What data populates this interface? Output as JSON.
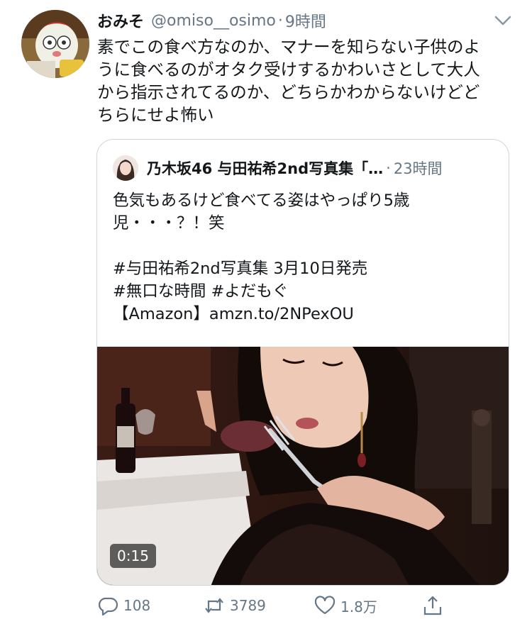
{
  "tweet": {
    "display_name": "おみそ",
    "handle": "@omiso__osimo",
    "separator": "·",
    "time": "9時間",
    "text_lines": [
      "素でこの食べ方なのか、マナーを知らない子供のよ",
      "うに食べるのがオタク受けするかわいさとして大人",
      "から指示されてるのか、どちらかわからないけどど",
      "ちらにせよ怖い"
    ]
  },
  "quote": {
    "display_name": "乃木坂46 与田祐希2nd写真集「…",
    "separator": "·",
    "time": "23時間",
    "text_lines": [
      "色気もあるけど食べてる姿はやっぱり5歳",
      "児・・・？！笑",
      "",
      "#与田祐希2nd写真集 3月10日発売",
      "#無口な時間 #よだもぐ",
      "【Amazon】amzn.to/2NPexOU"
    ],
    "video_duration": "0:15"
  },
  "actions": {
    "reply_count": "108",
    "retweet_count": "3789",
    "like_count": "1.8万"
  },
  "colors": {
    "text": "#14171a",
    "secondary": "#657786",
    "border": "#ccd6dd"
  }
}
